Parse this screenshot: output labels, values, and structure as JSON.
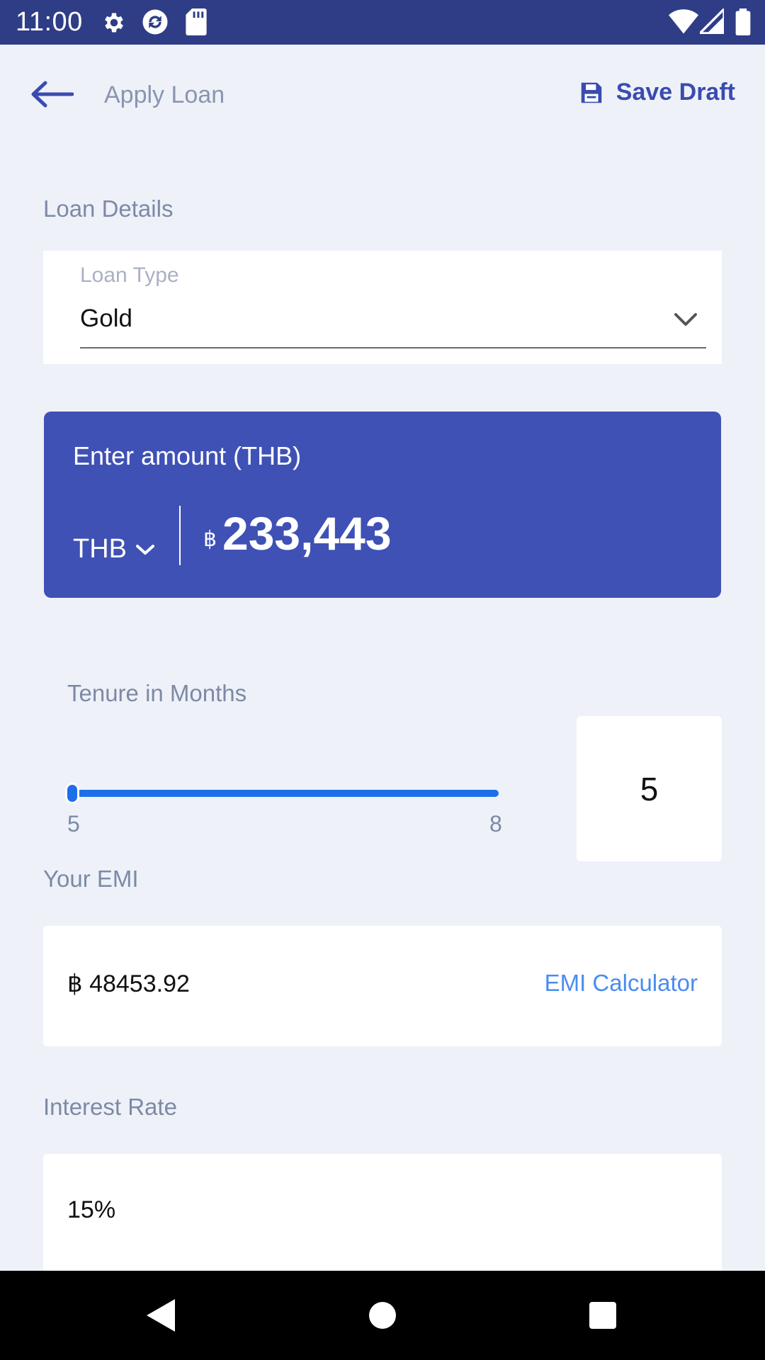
{
  "status_bar": {
    "time": "11:00",
    "icons": [
      "gear-icon",
      "sync-icon",
      "sd-card-icon",
      "wifi-icon",
      "signal-icon",
      "battery-icon"
    ]
  },
  "header": {
    "back_icon": "arrow-left-icon",
    "title": "Apply Loan",
    "save_icon": "floppy-disk-icon",
    "save_label": "Save Draft"
  },
  "loan_details": {
    "section_label": "Loan Details",
    "loan_type_label": "Loan Type",
    "loan_type_value": "Gold"
  },
  "amount": {
    "label": "Enter amount (THB)",
    "currency": "THB",
    "symbol": "฿",
    "value": "233,443"
  },
  "tenure": {
    "label": "Tenure in Months",
    "min": "5",
    "max": "8",
    "current": "5",
    "slider_fraction": 0.0
  },
  "emi": {
    "label": "Your EMI",
    "value": "฿ 48453.92",
    "calculator_link": "EMI Calculator"
  },
  "interest": {
    "label": "Interest Rate",
    "value": "15%"
  },
  "colors": {
    "status_bar": "#2F3D86",
    "primary": "#3F51B5",
    "accent": "#1E6EEA",
    "link": "#4A8CF0",
    "background": "#EEF1F8"
  }
}
